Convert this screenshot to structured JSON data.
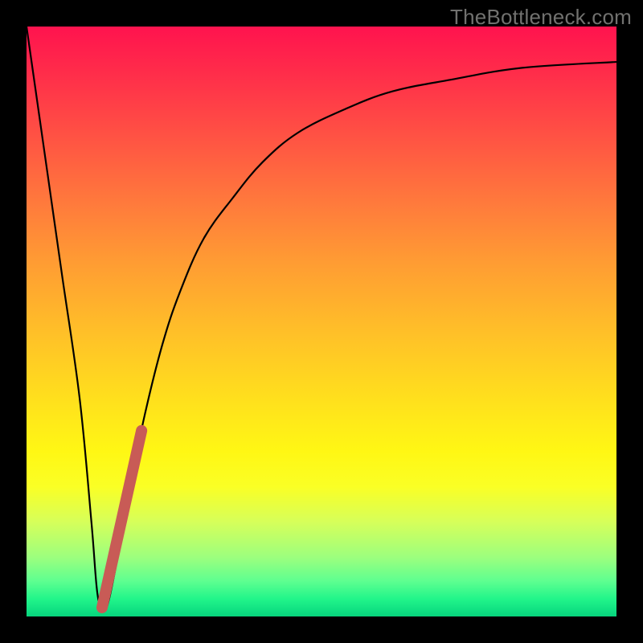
{
  "attribution": "TheBottleneck.com",
  "chart_data": {
    "type": "line",
    "title": "",
    "xlabel": "",
    "ylabel": "",
    "xlim": [
      0,
      100
    ],
    "ylim": [
      0,
      100
    ],
    "series": [
      {
        "name": "bottleneck-curve",
        "x": [
          0,
          3,
          6,
          9,
          11,
          12,
          13,
          14,
          16,
          18,
          20,
          23,
          26,
          30,
          35,
          40,
          46,
          54,
          62,
          72,
          84,
          100
        ],
        "y": [
          100,
          79,
          58,
          37,
          16,
          4,
          1,
          3,
          13,
          24,
          34,
          46,
          55,
          64,
          71,
          77,
          82,
          86,
          89,
          91,
          93,
          94
        ]
      },
      {
        "name": "highlight-segment",
        "x": [
          12.8,
          19.5
        ],
        "y": [
          1.5,
          31.5
        ]
      }
    ],
    "gradient_stops": [
      {
        "pos": 0,
        "color": "#ff134e"
      },
      {
        "pos": 50,
        "color": "#ffc028"
      },
      {
        "pos": 75,
        "color": "#fff714"
      },
      {
        "pos": 100,
        "color": "#07d37c"
      }
    ]
  }
}
